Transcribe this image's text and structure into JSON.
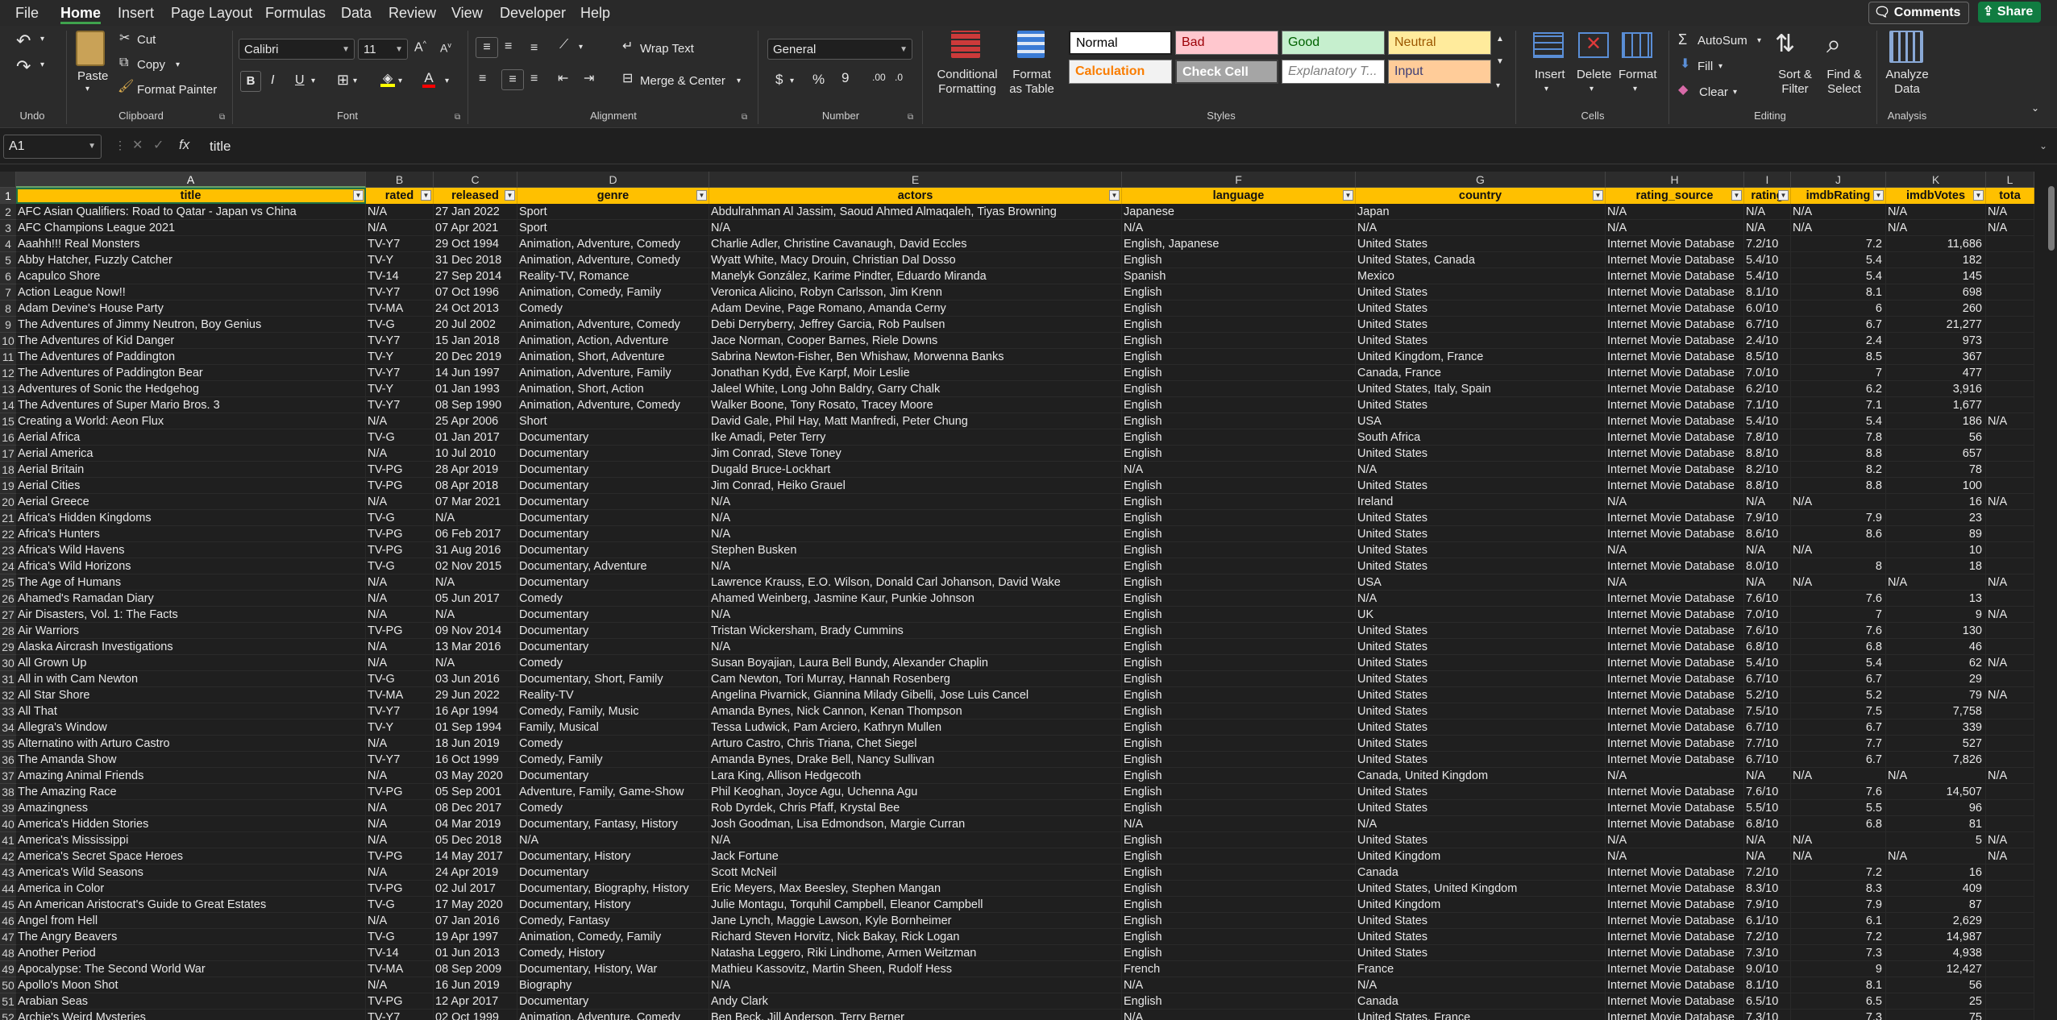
{
  "menu": {
    "items": [
      "File",
      "Home",
      "Insert",
      "Page Layout",
      "Formulas",
      "Data",
      "Review",
      "View",
      "Developer",
      "Help"
    ],
    "active": "Home",
    "comments_label": "Comments",
    "share_label": "Share"
  },
  "ribbon": {
    "undo": {
      "group_label": "Undo"
    },
    "clipboard": {
      "paste": "Paste",
      "cut": "Cut",
      "copy": "Copy",
      "format_painter": "Format Painter",
      "group_label": "Clipboard"
    },
    "font": {
      "font_name": "Calibri",
      "font_size": "11",
      "group_label": "Font"
    },
    "alignment": {
      "wrap_text": "Wrap Text",
      "merge_center": "Merge & Center",
      "group_label": "Alignment"
    },
    "number": {
      "format": "General",
      "group_label": "Number"
    },
    "styles": {
      "conditional_formatting": "Conditional Formatting",
      "format_as_table": "Format as Table",
      "cells": [
        {
          "label": "Normal",
          "bg": "#ffffff",
          "fg": "#000000"
        },
        {
          "label": "Bad",
          "bg": "#ffc7ce",
          "fg": "#9c0006"
        },
        {
          "label": "Good",
          "bg": "#c6efce",
          "fg": "#006100"
        },
        {
          "label": "Neutral",
          "bg": "#ffeb9c",
          "fg": "#9c5700"
        },
        {
          "label": "Calculation",
          "bg": "#f2f2f2",
          "fg": "#fa7d00"
        },
        {
          "label": "Check Cell",
          "bg": "#a5a5a5",
          "fg": "#ffffff"
        },
        {
          "label": "Explanatory T...",
          "bg": "#ffffff",
          "fg": "#7f7f7f"
        },
        {
          "label": "Input",
          "bg": "#ffcc99",
          "fg": "#3f3f76"
        }
      ],
      "group_label": "Styles"
    },
    "cells": {
      "insert": "Insert",
      "delete": "Delete",
      "format": "Format",
      "group_label": "Cells"
    },
    "editing": {
      "autosum": "AutoSum",
      "fill": "Fill",
      "clear": "Clear",
      "sort_filter": "Sort & Filter",
      "find_select": "Find & Select",
      "group_label": "Editing"
    },
    "analysis": {
      "analyze_data": "Analyze Data",
      "group_label": "Analysis"
    }
  },
  "formula_bar": {
    "name_box": "A1",
    "content": "title"
  },
  "sheet": {
    "columns": [
      "A",
      "B",
      "C",
      "D",
      "E",
      "F",
      "G",
      "H",
      "I",
      "J",
      "K",
      "L"
    ],
    "headers": [
      "title",
      "rated",
      "released",
      "genre",
      "actors",
      "language",
      "country",
      "rating_source",
      "rating",
      "imdbRating",
      "imdbVotes",
      "tota"
    ],
    "rows": [
      [
        "AFC Asian Qualifiers: Road to Qatar - Japan vs China",
        "N/A",
        "27 Jan 2022",
        "Sport",
        "Abdulrahman Al Jassim, Saoud Ahmed Almaqaleh, Tiyas Browning",
        "Japanese",
        "Japan",
        "N/A",
        "N/A",
        "N/A",
        "N/A",
        "N/A"
      ],
      [
        "AFC Champions League 2021",
        "N/A",
        "07 Apr 2021",
        "Sport",
        "N/A",
        "N/A",
        "N/A",
        "N/A",
        "N/A",
        "N/A",
        "N/A",
        "N/A"
      ],
      [
        "Aaahh!!! Real Monsters",
        "TV-Y7",
        "29 Oct 1994",
        "Animation, Adventure, Comedy",
        "Charlie Adler, Christine Cavanaugh, David Eccles",
        "English, Japanese",
        "United States",
        "Internet Movie Database",
        "7.2/10",
        "7.2",
        "11,686",
        ""
      ],
      [
        "Abby Hatcher, Fuzzly Catcher",
        "TV-Y",
        "31 Dec 2018",
        "Animation, Adventure, Comedy",
        "Wyatt White, Macy Drouin, Christian Dal Dosso",
        "English",
        "United States, Canada",
        "Internet Movie Database",
        "5.4/10",
        "5.4",
        "182",
        ""
      ],
      [
        "Acapulco Shore",
        "TV-14",
        "27 Sep 2014",
        "Reality-TV, Romance",
        "Manelyk González, Karime Pindter, Eduardo Miranda",
        "Spanish",
        "Mexico",
        "Internet Movie Database",
        "5.4/10",
        "5.4",
        "145",
        ""
      ],
      [
        "Action League Now!!",
        "TV-Y7",
        "07 Oct 1996",
        "Animation, Comedy, Family",
        "Veronica Alicino, Robyn Carlsson, Jim Krenn",
        "English",
        "United States",
        "Internet Movie Database",
        "8.1/10",
        "8.1",
        "698",
        ""
      ],
      [
        "Adam Devine's House Party",
        "TV-MA",
        "24 Oct 2013",
        "Comedy",
        "Adam Devine, Page Romano, Amanda Cerny",
        "English",
        "United States",
        "Internet Movie Database",
        "6.0/10",
        "6",
        "260",
        ""
      ],
      [
        "The Adventures of Jimmy Neutron, Boy Genius",
        "TV-G",
        "20 Jul 2002",
        "Animation, Adventure, Comedy",
        "Debi Derryberry, Jeffrey Garcia, Rob Paulsen",
        "English",
        "United States",
        "Internet Movie Database",
        "6.7/10",
        "6.7",
        "21,277",
        ""
      ],
      [
        "The Adventures of Kid Danger",
        "TV-Y7",
        "15 Jan 2018",
        "Animation, Action, Adventure",
        "Jace Norman, Cooper Barnes, Riele Downs",
        "English",
        "United States",
        "Internet Movie Database",
        "2.4/10",
        "2.4",
        "973",
        ""
      ],
      [
        "The Adventures of Paddington",
        "TV-Y",
        "20 Dec 2019",
        "Animation, Short, Adventure",
        "Sabrina Newton-Fisher, Ben Whishaw, Morwenna Banks",
        "English",
        "United Kingdom, France",
        "Internet Movie Database",
        "8.5/10",
        "8.5",
        "367",
        ""
      ],
      [
        "The Adventures of Paddington Bear",
        "TV-Y7",
        "14 Jun 1997",
        "Animation, Adventure, Family",
        "Jonathan Kydd, Ève Karpf, Moir Leslie",
        "English",
        "Canada, France",
        "Internet Movie Database",
        "7.0/10",
        "7",
        "477",
        ""
      ],
      [
        "Adventures of Sonic the Hedgehog",
        "TV-Y",
        "01 Jan 1993",
        "Animation, Short, Action",
        "Jaleel White, Long John Baldry, Garry Chalk",
        "English",
        "United States, Italy, Spain",
        "Internet Movie Database",
        "6.2/10",
        "6.2",
        "3,916",
        ""
      ],
      [
        "The Adventures of Super Mario Bros. 3",
        "TV-Y7",
        "08 Sep 1990",
        "Animation, Adventure, Comedy",
        "Walker Boone, Tony Rosato, Tracey Moore",
        "English",
        "United States",
        "Internet Movie Database",
        "7.1/10",
        "7.1",
        "1,677",
        ""
      ],
      [
        "Creating a World: Aeon Flux",
        "N/A",
        "25 Apr 2006",
        "Short",
        "David Gale, Phil Hay, Matt Manfredi, Peter Chung",
        "English",
        "USA",
        "Internet Movie Database",
        "5.4/10",
        "5.4",
        "186",
        "N/A"
      ],
      [
        "Aerial Africa",
        "TV-G",
        "01 Jan 2017",
        "Documentary",
        "Ike Amadi, Peter Terry",
        "English",
        "South Africa",
        "Internet Movie Database",
        "7.8/10",
        "7.8",
        "56",
        ""
      ],
      [
        "Aerial America",
        "N/A",
        "10 Jul 2010",
        "Documentary",
        "Jim Conrad, Steve Toney",
        "English",
        "United States",
        "Internet Movie Database",
        "8.8/10",
        "8.8",
        "657",
        ""
      ],
      [
        "Aerial Britain",
        "TV-PG",
        "28 Apr 2019",
        "Documentary",
        "Dugald Bruce-Lockhart",
        "N/A",
        "N/A",
        "Internet Movie Database",
        "8.2/10",
        "8.2",
        "78",
        ""
      ],
      [
        "Aerial Cities",
        "TV-PG",
        "08 Apr 2018",
        "Documentary",
        "Jim Conrad, Heiko Grauel",
        "English",
        "United States",
        "Internet Movie Database",
        "8.8/10",
        "8.8",
        "100",
        ""
      ],
      [
        "Aerial Greece",
        "N/A",
        "07 Mar 2021",
        "Documentary",
        "N/A",
        "English",
        "Ireland",
        "N/A",
        "N/A",
        "N/A",
        "16",
        "N/A"
      ],
      [
        "Africa's Hidden Kingdoms",
        "TV-G",
        "N/A",
        "Documentary",
        "N/A",
        "English",
        "United States",
        "Internet Movie Database",
        "7.9/10",
        "7.9",
        "23",
        ""
      ],
      [
        "Africa's Hunters",
        "TV-PG",
        "06 Feb 2017",
        "Documentary",
        "N/A",
        "English",
        "United States",
        "Internet Movie Database",
        "8.6/10",
        "8.6",
        "89",
        ""
      ],
      [
        "Africa's Wild Havens",
        "TV-PG",
        "31 Aug 2016",
        "Documentary",
        "Stephen Busken",
        "English",
        "United States",
        "N/A",
        "N/A",
        "N/A",
        "10",
        ""
      ],
      [
        "Africa's Wild Horizons",
        "TV-G",
        "02 Nov 2015",
        "Documentary, Adventure",
        "N/A",
        "English",
        "United States",
        "Internet Movie Database",
        "8.0/10",
        "8",
        "18",
        ""
      ],
      [
        "The Age of Humans",
        "N/A",
        "N/A",
        "Documentary",
        "Lawrence Krauss, E.O. Wilson, Donald Carl Johanson, David Wake",
        "English",
        "USA",
        "N/A",
        "N/A",
        "N/A",
        "N/A",
        "N/A"
      ],
      [
        "Ahamed's Ramadan Diary",
        "N/A",
        "05 Jun 2017",
        "Comedy",
        "Ahamed Weinberg, Jasmine Kaur, Punkie Johnson",
        "English",
        "N/A",
        "Internet Movie Database",
        "7.6/10",
        "7.6",
        "13",
        ""
      ],
      [
        "Air Disasters, Vol. 1: The Facts",
        "N/A",
        "N/A",
        "Documentary",
        "N/A",
        "English",
        "UK",
        "Internet Movie Database",
        "7.0/10",
        "7",
        "9",
        "N/A"
      ],
      [
        "Air Warriors",
        "TV-PG",
        "09 Nov 2014",
        "Documentary",
        "Tristan Wickersham, Brady Cummins",
        "English",
        "United States",
        "Internet Movie Database",
        "7.6/10",
        "7.6",
        "130",
        ""
      ],
      [
        "Alaska Aircrash Investigations",
        "N/A",
        "13 Mar 2016",
        "Documentary",
        "N/A",
        "English",
        "United States",
        "Internet Movie Database",
        "6.8/10",
        "6.8",
        "46",
        ""
      ],
      [
        "All Grown Up",
        "N/A",
        "N/A",
        "Comedy",
        "Susan Boyajian, Laura Bell Bundy, Alexander Chaplin",
        "English",
        "United States",
        "Internet Movie Database",
        "5.4/10",
        "5.4",
        "62",
        "N/A"
      ],
      [
        "All in with Cam Newton",
        "TV-G",
        "03 Jun 2016",
        "Documentary, Short, Family",
        "Cam Newton, Tori Murray, Hannah Rosenberg",
        "English",
        "United States",
        "Internet Movie Database",
        "6.7/10",
        "6.7",
        "29",
        ""
      ],
      [
        "All Star Shore",
        "TV-MA",
        "29 Jun 2022",
        "Reality-TV",
        "Angelina Pivarnick, Giannina Milady Gibelli, Jose Luis Cancel",
        "English",
        "United States",
        "Internet Movie Database",
        "5.2/10",
        "5.2",
        "79",
        "N/A"
      ],
      [
        "All That",
        "TV-Y7",
        "16 Apr 1994",
        "Comedy, Family, Music",
        "Amanda Bynes, Nick Cannon, Kenan Thompson",
        "English",
        "United States",
        "Internet Movie Database",
        "7.5/10",
        "7.5",
        "7,758",
        ""
      ],
      [
        "Allegra's Window",
        "TV-Y",
        "01 Sep 1994",
        "Family, Musical",
        "Tessa Ludwick, Pam Arciero, Kathryn Mullen",
        "English",
        "United States",
        "Internet Movie Database",
        "6.7/10",
        "6.7",
        "339",
        ""
      ],
      [
        "Alternatino with Arturo Castro",
        "N/A",
        "18 Jun 2019",
        "Comedy",
        "Arturo Castro, Chris Triana, Chet Siegel",
        "English",
        "United States",
        "Internet Movie Database",
        "7.7/10",
        "7.7",
        "527",
        ""
      ],
      [
        "The Amanda Show",
        "TV-Y7",
        "16 Oct 1999",
        "Comedy, Family",
        "Amanda Bynes, Drake Bell, Nancy Sullivan",
        "English",
        "United States",
        "Internet Movie Database",
        "6.7/10",
        "6.7",
        "7,826",
        ""
      ],
      [
        "Amazing Animal Friends",
        "N/A",
        "03 May 2020",
        "Documentary",
        "Lara King, Allison Hedgecoth",
        "English",
        "Canada, United Kingdom",
        "N/A",
        "N/A",
        "N/A",
        "N/A",
        "N/A"
      ],
      [
        "The Amazing Race",
        "TV-PG",
        "05 Sep 2001",
        "Adventure, Family, Game-Show",
        "Phil Keoghan, Joyce Agu, Uchenna Agu",
        "English",
        "United States",
        "Internet Movie Database",
        "7.6/10",
        "7.6",
        "14,507",
        ""
      ],
      [
        "Amazingness",
        "N/A",
        "08 Dec 2017",
        "Comedy",
        "Rob Dyrdek, Chris Pfaff, Krystal Bee",
        "English",
        "United States",
        "Internet Movie Database",
        "5.5/10",
        "5.5",
        "96",
        ""
      ],
      [
        "America's Hidden Stories",
        "N/A",
        "04 Mar 2019",
        "Documentary, Fantasy, History",
        "Josh Goodman, Lisa Edmondson, Margie Curran",
        "N/A",
        "N/A",
        "Internet Movie Database",
        "6.8/10",
        "6.8",
        "81",
        ""
      ],
      [
        "America's Mississippi",
        "N/A",
        "05 Dec 2018",
        "N/A",
        "N/A",
        "English",
        "United States",
        "N/A",
        "N/A",
        "N/A",
        "5",
        "N/A"
      ],
      [
        "America's Secret Space Heroes",
        "TV-PG",
        "14 May 2017",
        "Documentary, History",
        "Jack Fortune",
        "English",
        "United Kingdom",
        "N/A",
        "N/A",
        "N/A",
        "N/A",
        "N/A"
      ],
      [
        "America's Wild Seasons",
        "N/A",
        "24 Apr 2019",
        "Documentary",
        "Scott McNeil",
        "English",
        "Canada",
        "Internet Movie Database",
        "7.2/10",
        "7.2",
        "16",
        ""
      ],
      [
        "America in Color",
        "TV-PG",
        "02 Jul 2017",
        "Documentary, Biography, History",
        "Eric Meyers, Max Beesley, Stephen Mangan",
        "English",
        "United States, United Kingdom",
        "Internet Movie Database",
        "8.3/10",
        "8.3",
        "409",
        ""
      ],
      [
        "An American Aristocrat's Guide to Great Estates",
        "TV-G",
        "17 May 2020",
        "Documentary, History",
        "Julie Montagu, Torquhil Campbell, Eleanor Campbell",
        "English",
        "United Kingdom",
        "Internet Movie Database",
        "7.9/10",
        "7.9",
        "87",
        ""
      ],
      [
        "Angel from Hell",
        "N/A",
        "07 Jan 2016",
        "Comedy, Fantasy",
        "Jane Lynch, Maggie Lawson, Kyle Bornheimer",
        "English",
        "United States",
        "Internet Movie Database",
        "6.1/10",
        "6.1",
        "2,629",
        ""
      ],
      [
        "The Angry Beavers",
        "TV-G",
        "19 Apr 1997",
        "Animation, Comedy, Family",
        "Richard Steven Horvitz, Nick Bakay, Rick Logan",
        "English",
        "United States",
        "Internet Movie Database",
        "7.2/10",
        "7.2",
        "14,987",
        ""
      ],
      [
        "Another Period",
        "TV-14",
        "01 Jun 2013",
        "Comedy, History",
        "Natasha Leggero, Riki Lindhome, Armen Weitzman",
        "English",
        "United States",
        "Internet Movie Database",
        "7.3/10",
        "7.3",
        "4,938",
        ""
      ],
      [
        "Apocalypse: The Second World War",
        "TV-MA",
        "08 Sep 2009",
        "Documentary, History, War",
        "Mathieu Kassovitz, Martin Sheen, Rudolf Hess",
        "French",
        "France",
        "Internet Movie Database",
        "9.0/10",
        "9",
        "12,427",
        ""
      ],
      [
        "Apollo's Moon Shot",
        "N/A",
        "16 Jun 2019",
        "Biography",
        "N/A",
        "N/A",
        "N/A",
        "Internet Movie Database",
        "8.1/10",
        "8.1",
        "56",
        ""
      ],
      [
        "Arabian Seas",
        "TV-PG",
        "12 Apr 2017",
        "Documentary",
        "Andy Clark",
        "English",
        "Canada",
        "Internet Movie Database",
        "6.5/10",
        "6.5",
        "25",
        ""
      ],
      [
        "Archie's Weird Mysteries",
        "TV-Y7",
        "02 Oct 1999",
        "Animation, Adventure, Comedy",
        "Ben Beck, Jill Anderson, Terry Berner",
        "N/A",
        "United States, France",
        "Internet Movie Database",
        "7.3/10",
        "7.3",
        "75",
        ""
      ]
    ]
  }
}
